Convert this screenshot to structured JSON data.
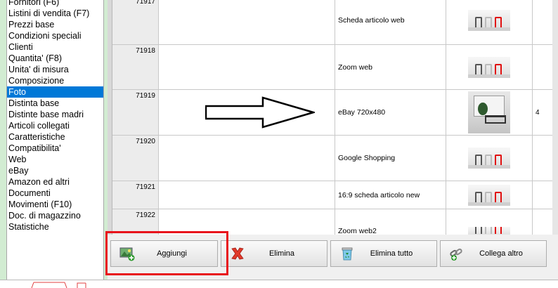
{
  "sidebar": {
    "items": [
      {
        "label": "Fornitori (F6)"
      },
      {
        "label": "Listini di vendita (F7)"
      },
      {
        "label": "Prezzi base"
      },
      {
        "label": "Condizioni speciali"
      },
      {
        "label": "Clienti"
      },
      {
        "label": "Quantita' (F8)"
      },
      {
        "label": "Unita' di misura"
      },
      {
        "label": "Composizione"
      },
      {
        "label": "Foto",
        "selected": true
      },
      {
        "label": "Distinta base"
      },
      {
        "label": "Distinte base madri"
      },
      {
        "label": "Articoli collegati"
      },
      {
        "label": "Caratteristiche"
      },
      {
        "label": "Compatibilita'"
      },
      {
        "label": "Web"
      },
      {
        "label": "eBay"
      },
      {
        "label": "Amazon ed altri"
      },
      {
        "label": "Documenti"
      },
      {
        "label": "Movimenti (F10)"
      },
      {
        "label": "Doc. di magazzino"
      },
      {
        "label": "Statistiche"
      }
    ]
  },
  "grid": {
    "rows": [
      {
        "id": "71917",
        "name": "Scheda articolo web",
        "image": "chairs-thumbnail",
        "extra": ""
      },
      {
        "id": "71918",
        "name": "Zoom web",
        "image": "chairs-thumbnail",
        "extra": ""
      },
      {
        "id": "71919",
        "name": "eBay 720x480",
        "image": "room-thumbnail",
        "extra": "4"
      },
      {
        "id": "71920",
        "name": "Google Shopping",
        "image": "chairs-thumbnail",
        "extra": ""
      },
      {
        "id": "71921",
        "name": "16:9 scheda articolo new",
        "image": "chairs-thumbnail",
        "extra": ""
      },
      {
        "id": "71922",
        "name": "Zoom web2",
        "image": "chairs-thumbnail",
        "extra": ""
      }
    ]
  },
  "toolbar": {
    "add_label": "Aggiungi",
    "delete_label": "Elimina",
    "delete_all_label": "Elimina tutto",
    "link_other_label": "Collega altro"
  },
  "colors": {
    "selection": "#0078d7",
    "highlight": "#e8141c",
    "sidebar_bg": "#d2ecd2"
  }
}
